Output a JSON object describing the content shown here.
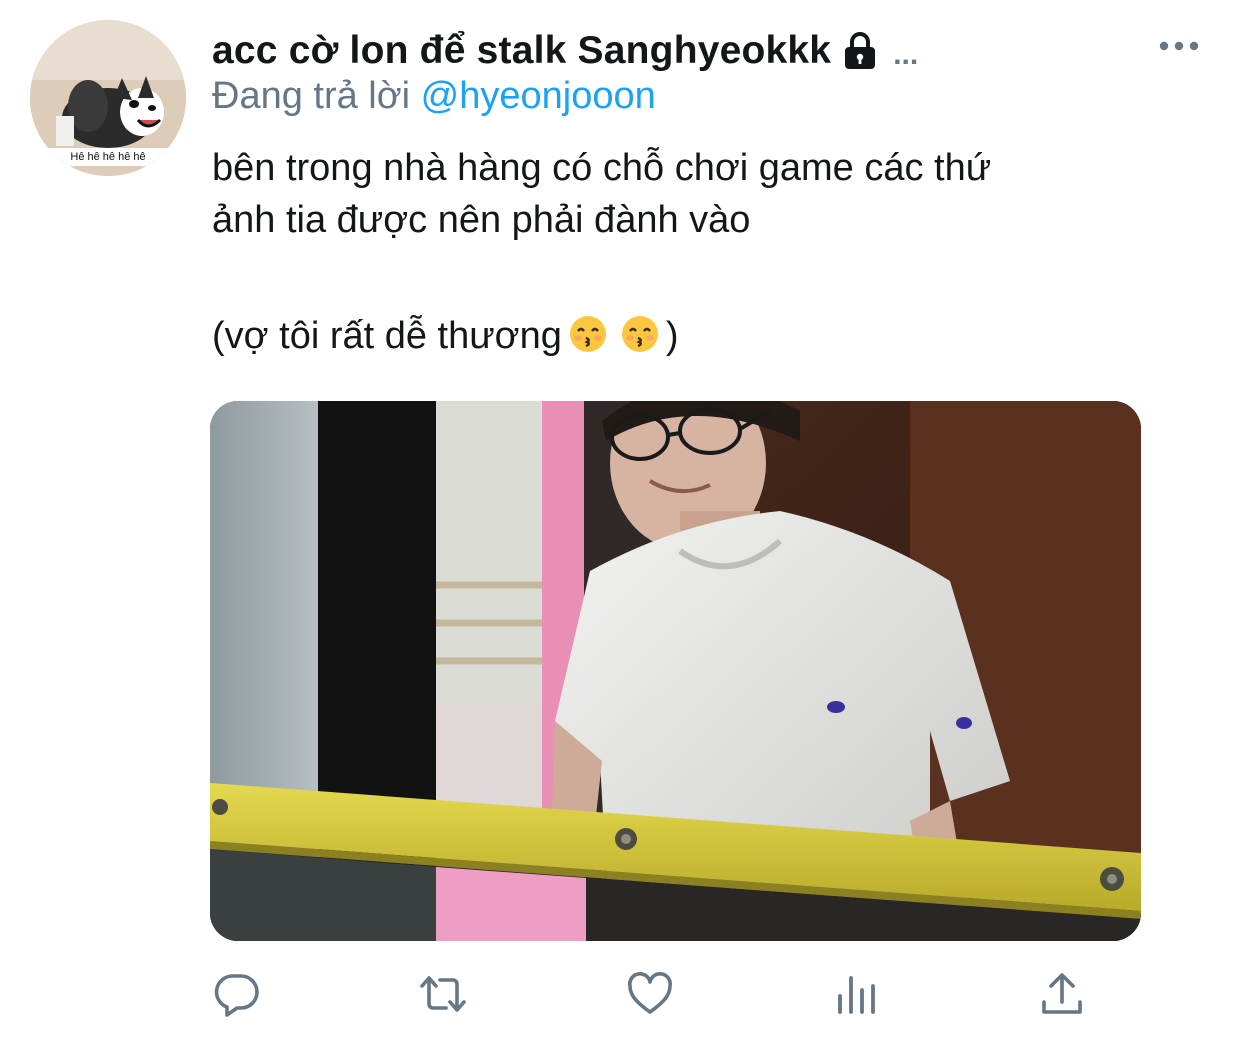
{
  "author": {
    "display_name": "acc cờ lon để stalk Sanghyeokkk",
    "name_overflow": "...",
    "protected_icon": "lock-icon",
    "avatar_caption": "Hê hê hê hê hê"
  },
  "reply": {
    "prefix": "Đang trả lời",
    "handle": "@hyeonjooon"
  },
  "tweet": {
    "line1": "bên trong nhà hàng có chỗ chơi game các thứ",
    "line2": "ảnh tia được nên phải đành vào",
    "line3_prefix": "(vợ tôi rất dễ thương",
    "line3_suffix": ")",
    "emoji": [
      "kissing-face-smiling-eyes",
      "kissing-face-smiling-eyes"
    ]
  },
  "actions": {
    "reply_icon": "reply-icon",
    "retweet_icon": "retweet-icon",
    "like_icon": "heart-icon",
    "analytics_icon": "analytics-icon",
    "share_icon": "share-icon",
    "more_icon": "more-icon"
  },
  "colors": {
    "text": "#14171a",
    "secondary": "#657786",
    "link": "#1da1f2",
    "icon": "#657786"
  }
}
